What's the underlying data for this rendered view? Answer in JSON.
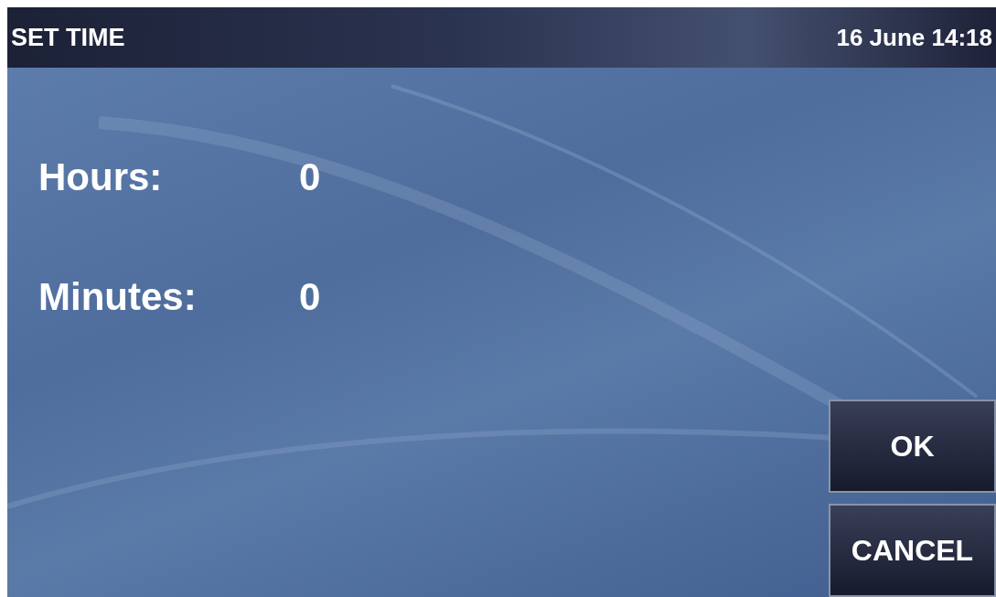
{
  "header": {
    "title": "SET TIME",
    "datetime": "16 June 14:18"
  },
  "fields": [
    {
      "label": "Hours:",
      "value": "0"
    },
    {
      "label": "Minutes:",
      "value": "0"
    }
  ],
  "buttons": [
    {
      "label": "OK"
    },
    {
      "label": "CANCEL"
    }
  ]
}
